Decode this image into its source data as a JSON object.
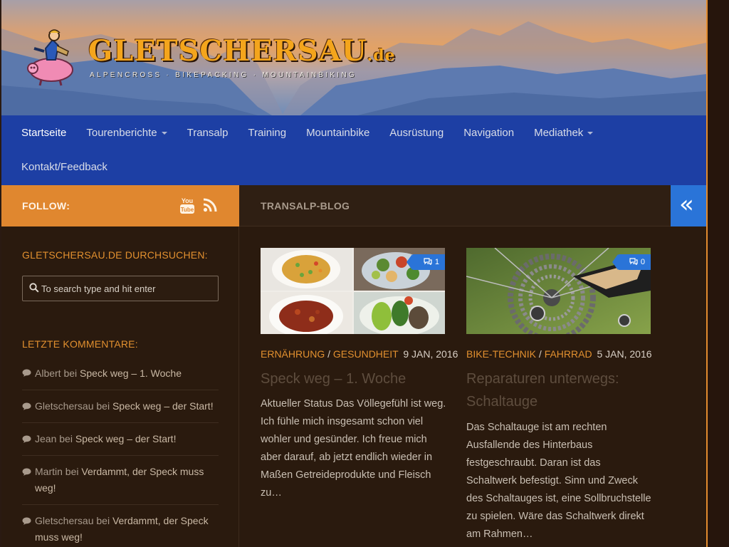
{
  "header": {
    "site_title": "GLETSCHERSAU",
    "site_tld": ".de",
    "tagline": "ALPENCROSS · BIKEPACKING · MOUNTAINBIKING",
    "logo_icon": "bike-pig-mascot-icon"
  },
  "nav": {
    "items": [
      {
        "label": "Startseite",
        "active": true,
        "has_dropdown": false
      },
      {
        "label": "Tourenberichte",
        "active": false,
        "has_dropdown": true
      },
      {
        "label": "Transalp",
        "active": false,
        "has_dropdown": false
      },
      {
        "label": "Training",
        "active": false,
        "has_dropdown": false
      },
      {
        "label": "Mountainbike",
        "active": false,
        "has_dropdown": false
      },
      {
        "label": "Ausrüstung",
        "active": false,
        "has_dropdown": false
      },
      {
        "label": "Navigation",
        "active": false,
        "has_dropdown": false
      },
      {
        "label": "Mediathek",
        "active": false,
        "has_dropdown": true
      },
      {
        "label": "Kontakt/Feedback",
        "active": false,
        "has_dropdown": false
      }
    ]
  },
  "follow": {
    "label": "FOLLOW:",
    "icons": [
      "youtube-icon",
      "rss-icon"
    ]
  },
  "blog": {
    "label": "TRANSALP-BLOG",
    "collapse_icon": "double-chevron-left-icon"
  },
  "sidebar": {
    "search_title": "GLETSCHERSAU.DE DURCHSUCHEN:",
    "search_placeholder": "To search type and hit enter",
    "comments_title": "LETZTE KOMMENTARE:",
    "comments": [
      {
        "author": "Albert",
        "bei": "bei",
        "post": "Speck weg – 1. Woche"
      },
      {
        "author": "Gletschersau",
        "bei": "bei",
        "post": "Speck weg – der Start!"
      },
      {
        "author": "Jean",
        "bei": "bei",
        "post": "Speck weg – der Start!"
      },
      {
        "author": "Martin",
        "bei": "bei",
        "post": "Verdammt, der Speck muss weg!"
      },
      {
        "author": "Gletschersau",
        "bei": "bei",
        "post": "Verdammt, der Speck muss weg!"
      }
    ]
  },
  "posts": [
    {
      "image": "food-collage-image",
      "comment_count": "1",
      "categories": [
        "ERNÄHRUNG",
        "GESUNDHEIT"
      ],
      "category_sep": "/",
      "date": "9 JAN, 2016",
      "title": "Speck weg – 1. Woche",
      "excerpt": "Aktueller Status Das Völlegefühl ist weg. Ich fühle mich insgesamt schon viel wohler und gesünder. Ich freue mich aber darauf, ab jetzt endlich wieder in Maßen Getreideprodukte und Fleisch zu…"
    },
    {
      "image": "bike-derailleur-image",
      "comment_count": "0",
      "categories": [
        "BIKE-TECHNIK",
        "FAHRRAD"
      ],
      "category_sep": "/",
      "date": "5 JAN, 2016",
      "title": "Reparaturen unterwegs: Schaltauge",
      "excerpt": "Das Schaltauge ist am rechten Ausfallende des Hinterbaus festgeschraubt. Daran ist das Schaltwerk befestigt. Sinn und Zweck des Schaltauges ist, eine Sollbruchstelle zu spielen. Wäre das Schaltwerk direkt am Rahmen…"
    }
  ],
  "colors": {
    "accent_orange": "#e0872f",
    "nav_blue": "#1d3fa4",
    "button_blue": "#2a74d8",
    "background": "#2a1a0e"
  }
}
